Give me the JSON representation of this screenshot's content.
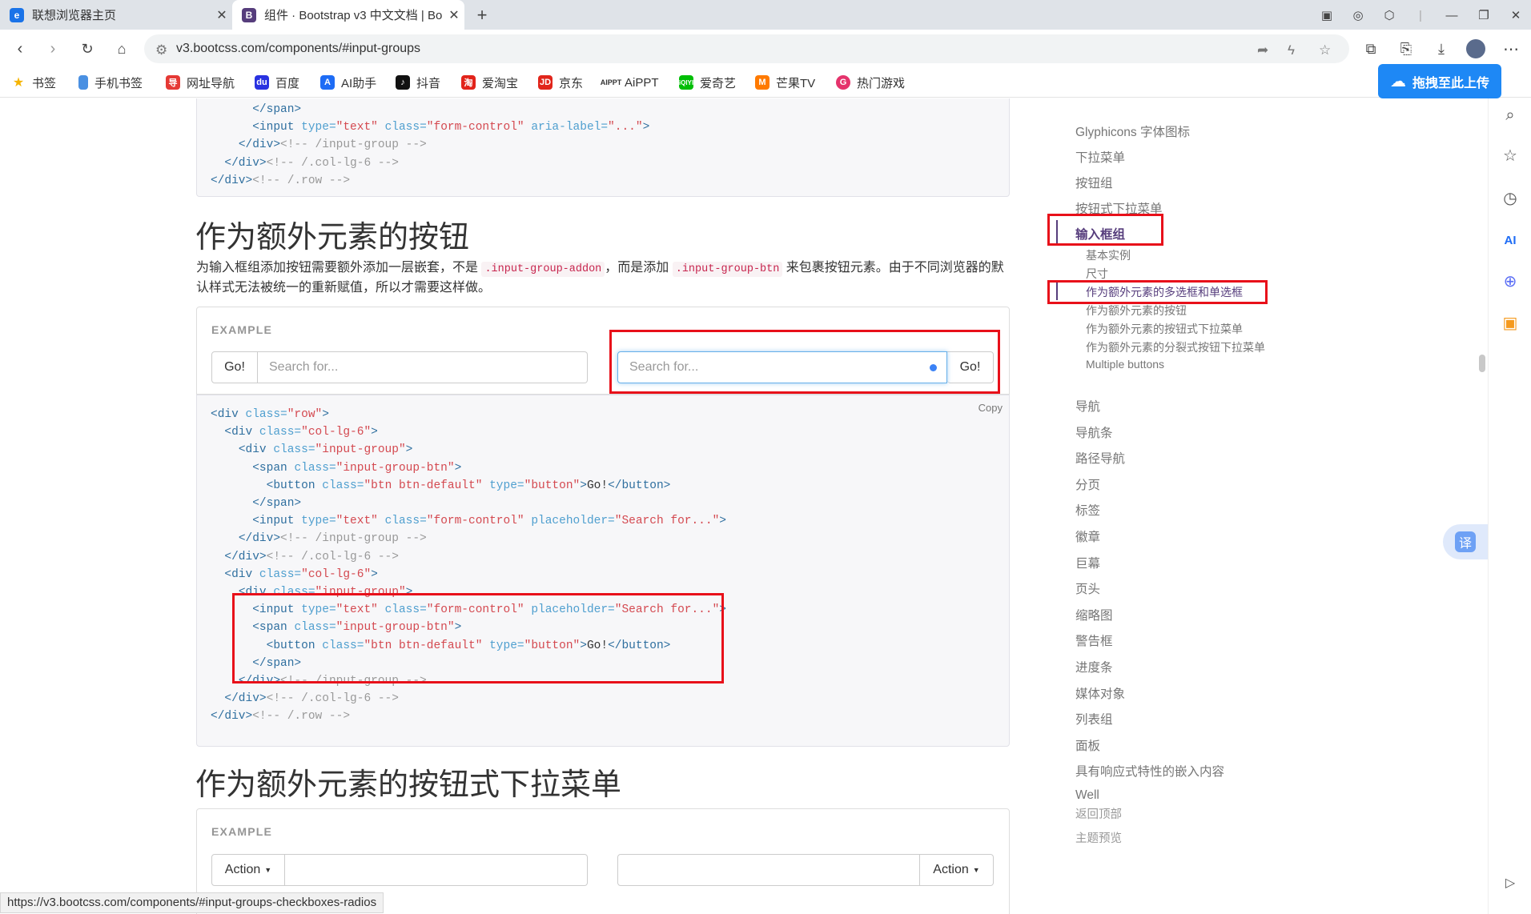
{
  "tabs": [
    {
      "title": "联想浏览器主页",
      "active": false
    },
    {
      "title": "组件 · Bootstrap v3 中文文档 | Bo",
      "active": true
    }
  ],
  "new_tab_label": "+",
  "address": {
    "url": "v3.bootcss.com/components/#input-groups"
  },
  "bookmarks": [
    "书签",
    "手机书签",
    "网址导航",
    "百度",
    "AI助手",
    "抖音",
    "爱淘宝",
    "京东",
    "AiPPT",
    "爱奇艺",
    "芒果TV",
    "热门游戏"
  ],
  "upload_button": "拖拽至此上传",
  "top_code": [
    {
      "indent": "      ",
      "parts": [
        [
          "tg",
          "</span>"
        ]
      ]
    },
    {
      "indent": "      ",
      "parts": [
        [
          "tg",
          "<input "
        ],
        [
          "at",
          "type="
        ],
        [
          "av",
          "\"text\""
        ],
        [
          "at",
          " class="
        ],
        [
          "av",
          "\"form-control\""
        ],
        [
          "at",
          " aria-label="
        ],
        [
          "av",
          "\"...\""
        ],
        [
          "tg",
          ">"
        ]
      ]
    },
    {
      "indent": "    ",
      "parts": [
        [
          "tg",
          "</div>"
        ],
        [
          "cm",
          "<!-- /input-group -->"
        ]
      ]
    },
    {
      "indent": "  ",
      "parts": [
        [
          "tg",
          "</div>"
        ],
        [
          "cm",
          "<!-- /.col-lg-6 -->"
        ]
      ]
    },
    {
      "indent": "",
      "parts": [
        [
          "tg",
          "</div>"
        ],
        [
          "cm",
          "<!-- /.row -->"
        ]
      ]
    }
  ],
  "section1": {
    "heading": "作为额外元素的按钮",
    "para_before": "为输入框组添加按钮需要额外添加一层嵌套，不是 ",
    "code1": ".input-group-addon",
    "para_mid": "，而是添加 ",
    "code2": ".input-group-btn",
    "para_after": " 来包裹按钮元素。由于不同浏览器的默认样式无法被统一的重新赋值，所以才需要这样做。",
    "example_label": "EXAMPLE",
    "left_button": "Go!",
    "left_placeholder": "Search for...",
    "right_placeholder": "Search for...",
    "right_button": "Go!",
    "copy_label": "Copy",
    "code": [
      {
        "indent": "",
        "parts": [
          [
            "tg",
            "<div "
          ],
          [
            "at",
            "class="
          ],
          [
            "av",
            "\"row\""
          ],
          [
            "tg",
            ">"
          ]
        ]
      },
      {
        "indent": "  ",
        "parts": [
          [
            "tg",
            "<div "
          ],
          [
            "at",
            "class="
          ],
          [
            "av",
            "\"col-lg-6\""
          ],
          [
            "tg",
            ">"
          ]
        ]
      },
      {
        "indent": "    ",
        "parts": [
          [
            "tg",
            "<div "
          ],
          [
            "at",
            "class="
          ],
          [
            "av",
            "\"input-group\""
          ],
          [
            "tg",
            ">"
          ]
        ]
      },
      {
        "indent": "      ",
        "parts": [
          [
            "tg",
            "<span "
          ],
          [
            "at",
            "class="
          ],
          [
            "av",
            "\"input-group-btn\""
          ],
          [
            "tg",
            ">"
          ]
        ]
      },
      {
        "indent": "        ",
        "parts": [
          [
            "tg",
            "<button "
          ],
          [
            "at",
            "class="
          ],
          [
            "av",
            "\"btn btn-default\""
          ],
          [
            "at",
            " type="
          ],
          [
            "av",
            "\"button\""
          ],
          [
            "tg",
            ">"
          ],
          [
            "tx",
            "Go!"
          ],
          [
            "tg",
            "</button>"
          ]
        ]
      },
      {
        "indent": "      ",
        "parts": [
          [
            "tg",
            "</span>"
          ]
        ]
      },
      {
        "indent": "      ",
        "parts": [
          [
            "tg",
            "<input "
          ],
          [
            "at",
            "type="
          ],
          [
            "av",
            "\"text\""
          ],
          [
            "at",
            " class="
          ],
          [
            "av",
            "\"form-control\""
          ],
          [
            "at",
            " placeholder="
          ],
          [
            "av",
            "\"Search for...\""
          ],
          [
            "tg",
            ">"
          ]
        ]
      },
      {
        "indent": "    ",
        "parts": [
          [
            "tg",
            "</div>"
          ],
          [
            "cm",
            "<!-- /input-group -->"
          ]
        ]
      },
      {
        "indent": "  ",
        "parts": [
          [
            "tg",
            "</div>"
          ],
          [
            "cm",
            "<!-- /.col-lg-6 -->"
          ]
        ]
      },
      {
        "indent": "  ",
        "parts": [
          [
            "tg",
            "<div "
          ],
          [
            "at",
            "class="
          ],
          [
            "av",
            "\"col-lg-6\""
          ],
          [
            "tg",
            ">"
          ]
        ]
      },
      {
        "indent": "    ",
        "parts": [
          [
            "tg",
            "<div "
          ],
          [
            "at",
            "class="
          ],
          [
            "av",
            "\"input-group\""
          ],
          [
            "tg",
            ">"
          ]
        ]
      },
      {
        "indent": "      ",
        "parts": [
          [
            "tg",
            "<input "
          ],
          [
            "at",
            "type="
          ],
          [
            "av",
            "\"text\""
          ],
          [
            "at",
            " class="
          ],
          [
            "av",
            "\"form-control\""
          ],
          [
            "at",
            " placeholder="
          ],
          [
            "av",
            "\"Search for...\""
          ],
          [
            "tg",
            ">"
          ]
        ]
      },
      {
        "indent": "      ",
        "parts": [
          [
            "tg",
            "<span "
          ],
          [
            "at",
            "class="
          ],
          [
            "av",
            "\"input-group-btn\""
          ],
          [
            "tg",
            ">"
          ]
        ]
      },
      {
        "indent": "        ",
        "parts": [
          [
            "tg",
            "<button "
          ],
          [
            "at",
            "class="
          ],
          [
            "av",
            "\"btn btn-default\""
          ],
          [
            "at",
            " type="
          ],
          [
            "av",
            "\"button\""
          ],
          [
            "tg",
            ">"
          ],
          [
            "tx",
            "Go!"
          ],
          [
            "tg",
            "</button>"
          ]
        ]
      },
      {
        "indent": "      ",
        "parts": [
          [
            "tg",
            "</span>"
          ]
        ]
      },
      {
        "indent": "    ",
        "parts": [
          [
            "tg",
            "</div>"
          ],
          [
            "cm",
            "<!-- /input-group -->"
          ]
        ]
      },
      {
        "indent": "  ",
        "parts": [
          [
            "tg",
            "</div>"
          ],
          [
            "cm",
            "<!-- /.col-lg-6 -->"
          ]
        ]
      },
      {
        "indent": "",
        "parts": [
          [
            "tg",
            "</div>"
          ],
          [
            "cm",
            "<!-- /.row -->"
          ]
        ]
      }
    ]
  },
  "section2": {
    "heading": "作为额外元素的按钮式下拉菜单",
    "example_label": "EXAMPLE",
    "left_button": "Action",
    "right_button": "Action"
  },
  "sidenav": {
    "items_top": [
      "Glyphicons 字体图标",
      "下拉菜单",
      "按钮组",
      "按钮式下拉菜单"
    ],
    "active": "输入框组",
    "sub_items": [
      "基本实例",
      "尺寸",
      "作为额外元素的多选框和单选框",
      "作为额外元素的按钮",
      "作为额外元素的按钮式下拉菜单",
      "作为额外元素的分裂式按钮下拉菜单",
      "Multiple buttons"
    ],
    "active_sub": "作为额外元素的多选框和单选框",
    "items_bottom": [
      "导航",
      "导航条",
      "路径导航",
      "分页",
      "标签",
      "徽章",
      "巨幕",
      "页头",
      "缩略图",
      "警告框",
      "进度条",
      "媒体对象",
      "列表组",
      "面板",
      "具有响应式特性的嵌入内容",
      "Well"
    ],
    "footer_links": [
      "返回顶部",
      "主题预览"
    ]
  },
  "translate_label": "译",
  "status_url": "https://v3.bootcss.com/components/#input-groups-checkboxes-radios"
}
